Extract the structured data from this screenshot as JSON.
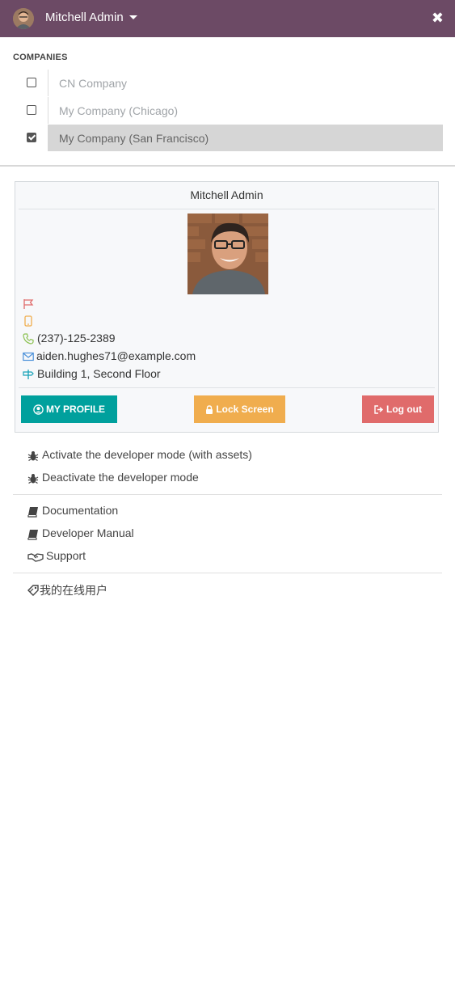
{
  "topbar": {
    "user_name": "Mitchell Admin",
    "close_glyph": "✖",
    "background": "#6c4a65"
  },
  "companies": {
    "title": "COMPANIES",
    "items": [
      {
        "name": "CN Company",
        "checked": false
      },
      {
        "name": "My Company (Chicago)",
        "checked": false
      },
      {
        "name": "My Company (San Francisco)",
        "checked": true
      }
    ]
  },
  "profile": {
    "name": "Mitchell Admin",
    "phone": "(237)-125-2389",
    "email": "aiden.hughes71@example.com",
    "location": "Building 1, Second Floor",
    "icons": [
      "flag-icon",
      "mobile-icon",
      "phone-icon",
      "envelope-icon",
      "signpost-icon"
    ],
    "buttons": {
      "my_profile": "MY PROFILE",
      "lock_screen": "Lock Screen",
      "log_out": "Log out"
    },
    "button_colors": {
      "my_profile": "#00a09d",
      "lock_screen": "#f0ad4e",
      "log_out": "#e06b6b"
    }
  },
  "menu": {
    "developer": [
      "Activate the developer mode (with assets)",
      "Deactivate the developer mode"
    ],
    "help": [
      "Documentation",
      "Developer Manual",
      "Support"
    ],
    "extra": "我的在线用户"
  }
}
